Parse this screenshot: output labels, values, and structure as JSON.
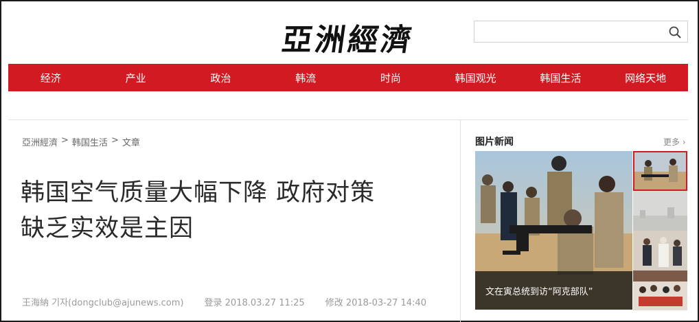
{
  "brand": {
    "logo_text": "亞洲經濟"
  },
  "search": {
    "placeholder": "",
    "value": ""
  },
  "nav": {
    "items": [
      {
        "label": "经济"
      },
      {
        "label": "产业"
      },
      {
        "label": "政治"
      },
      {
        "label": "韩流"
      },
      {
        "label": "时尚"
      },
      {
        "label": "韩国观光"
      },
      {
        "label": "韩国生活"
      },
      {
        "label": "网络天地"
      }
    ]
  },
  "breadcrumb": {
    "items": [
      "亞洲經濟",
      "韩国生活",
      "文章"
    ],
    "separator": ">"
  },
  "article": {
    "title_line1": "韩国空气质量大幅下降 政府对策",
    "title_line2": "缺乏实效是主因",
    "author": "王海納 기자(dongclub@ajunews.com)",
    "posted": "登录 2018.03.27 11:25",
    "modified": "修改 2018-03-27 14:40"
  },
  "sidebar": {
    "title": "图片新闻",
    "more_label": "更多 ›",
    "feature_caption": "文在寅总统到访“阿克部队”",
    "thumbs": [
      {
        "icon": "photo-soldiers-thumb",
        "active": true
      },
      {
        "icon": "photo-fog-thumb",
        "active": false
      },
      {
        "icon": "photo-people-thumb",
        "active": false
      },
      {
        "icon": "photo-crowd-thumb",
        "active": false
      }
    ]
  },
  "colors": {
    "nav_red": "#d11a22",
    "text_gray": "#9a9a9a"
  }
}
